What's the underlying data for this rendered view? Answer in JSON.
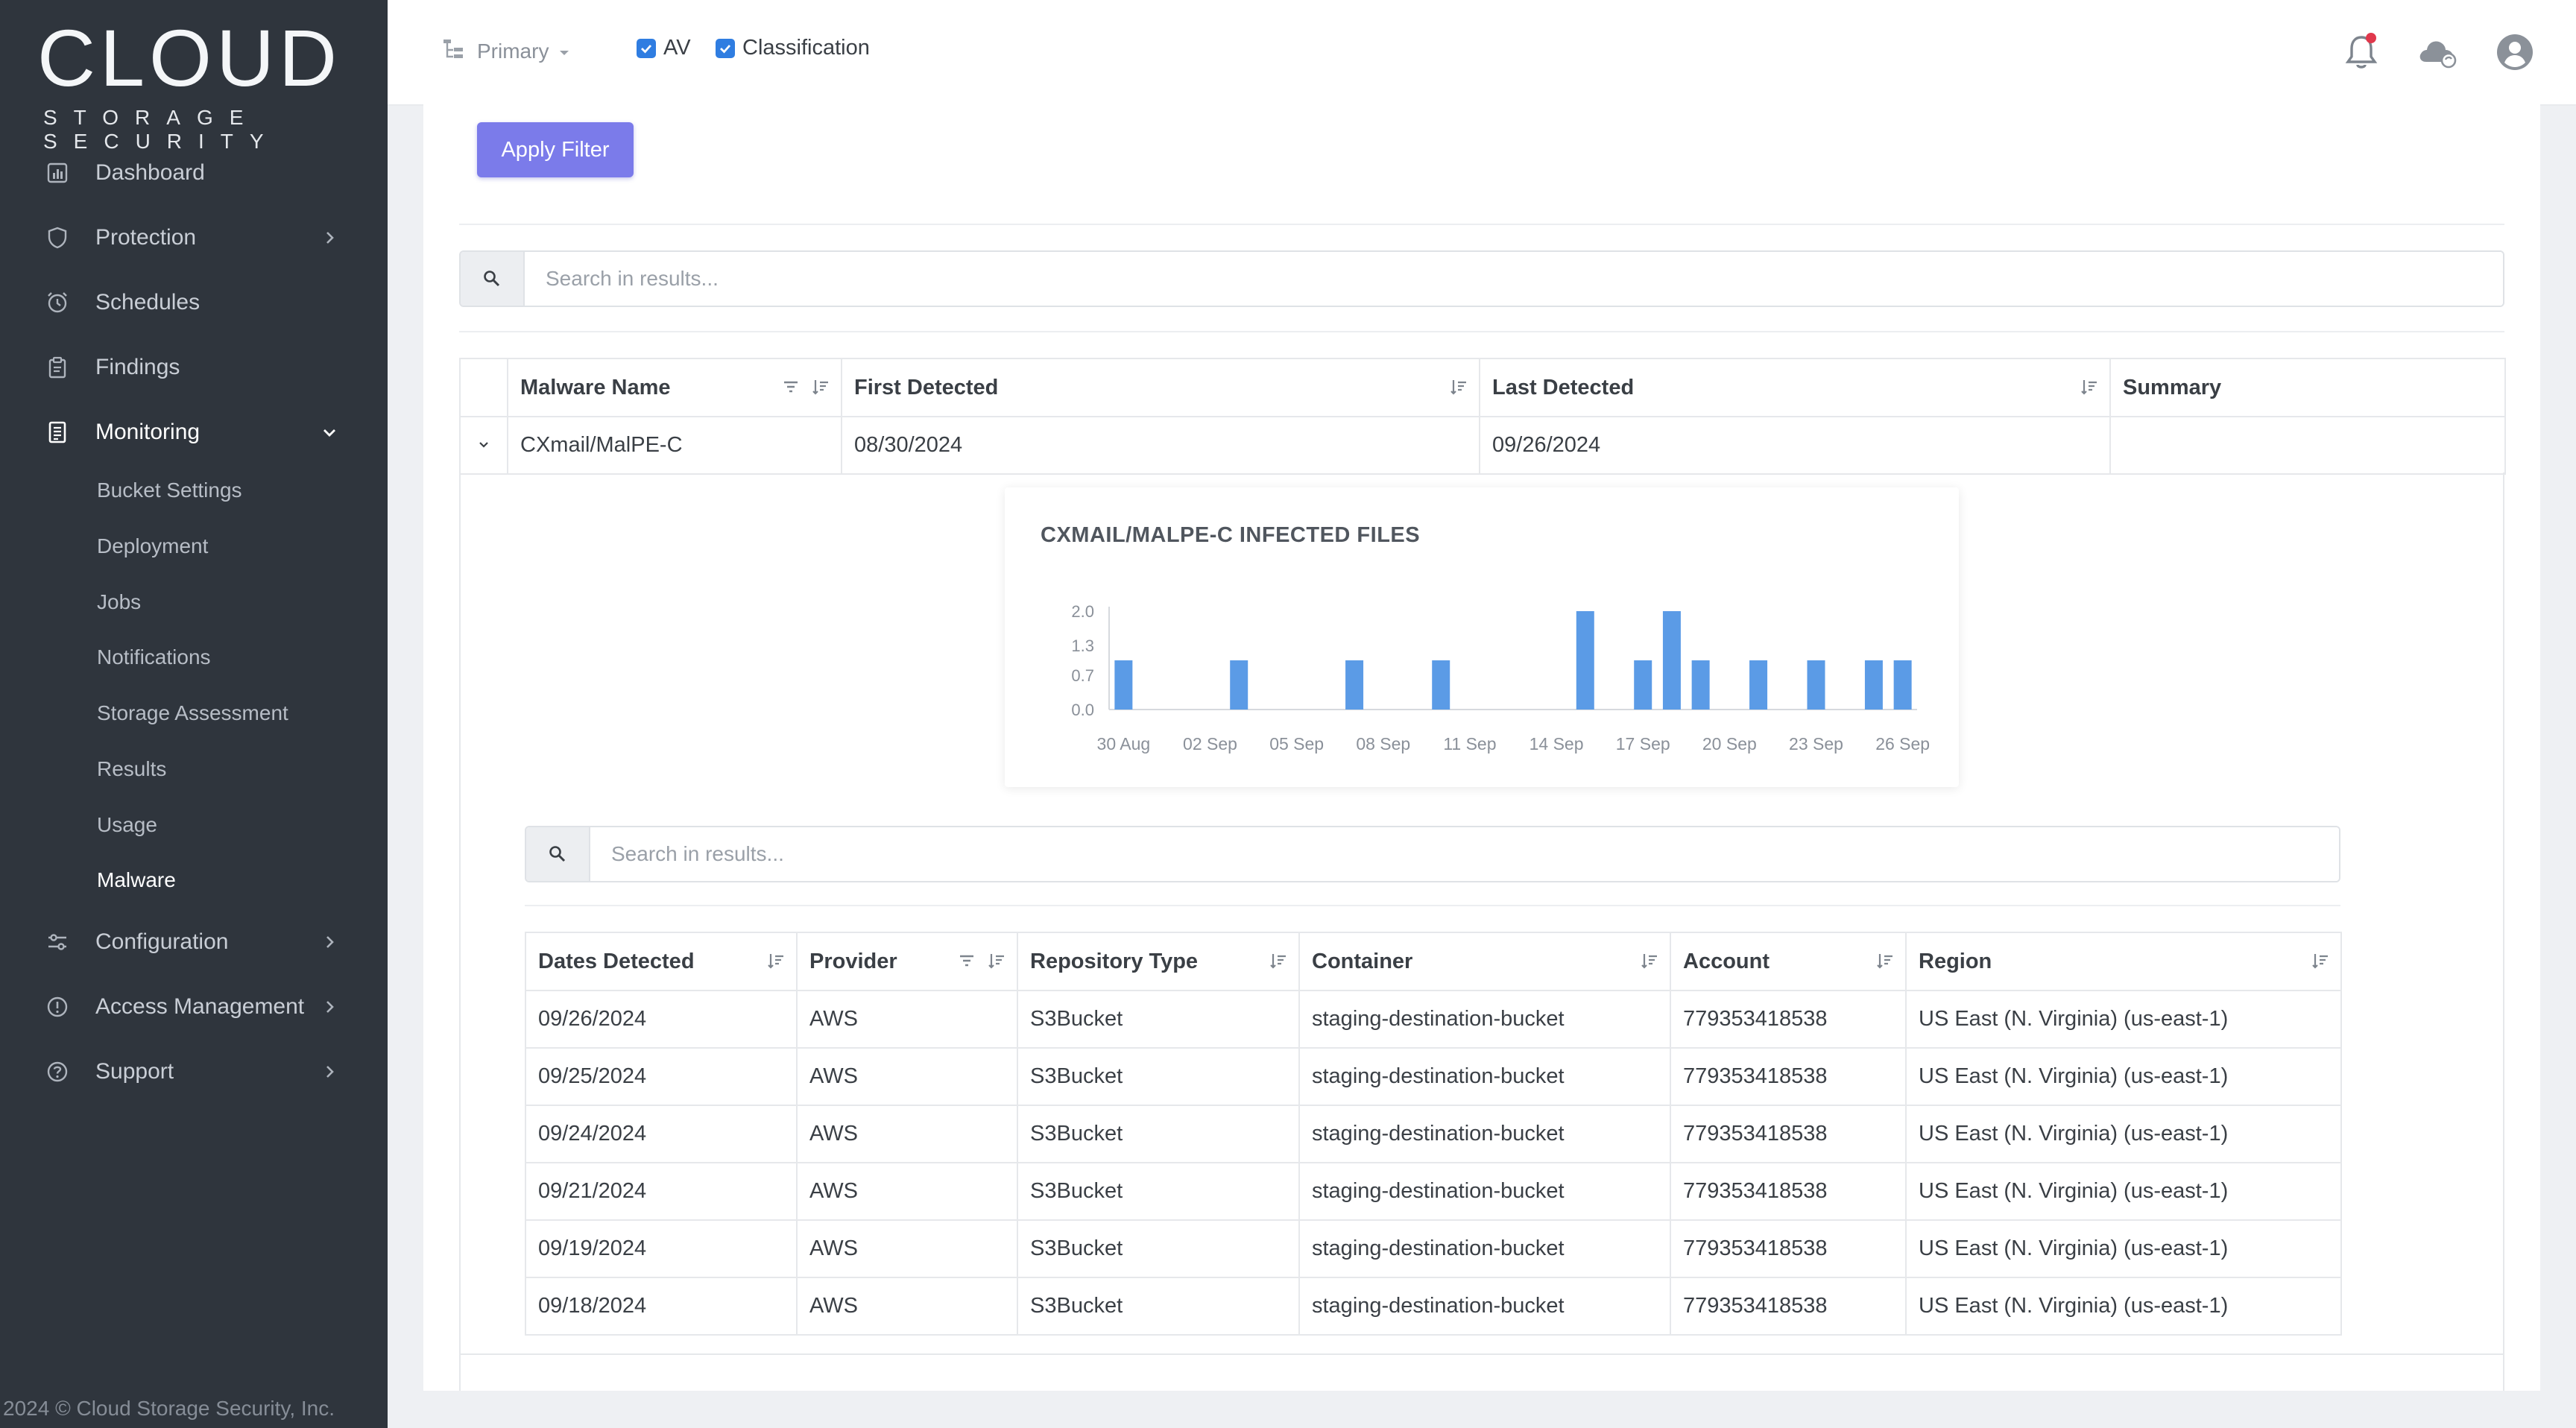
{
  "brand": {
    "main": "CLOUD",
    "sub": "STORAGE SECURITY"
  },
  "sidebar": {
    "items": [
      {
        "label": "Dashboard",
        "icon": "dashboard-icon",
        "chevron": false
      },
      {
        "label": "Protection",
        "icon": "shield-icon",
        "chevron": "right"
      },
      {
        "label": "Schedules",
        "icon": "alarm-clock-icon",
        "chevron": false
      },
      {
        "label": "Findings",
        "icon": "clipboard-icon",
        "chevron": false
      },
      {
        "label": "Monitoring",
        "icon": "document-icon",
        "chevron": "down"
      },
      {
        "label": "Configuration",
        "icon": "sliders-icon",
        "chevron": "right"
      },
      {
        "label": "Access Management",
        "icon": "info-circle-icon",
        "chevron": "right"
      },
      {
        "label": "Support",
        "icon": "help-circle-icon",
        "chevron": "right"
      }
    ],
    "monitoring_sub": [
      "Bucket Settings",
      "Deployment",
      "Jobs",
      "Notifications",
      "Storage Assessment",
      "Results",
      "Usage",
      "Malware"
    ],
    "active_sub": "Malware",
    "copyright": "2024 © Cloud Storage Security, Inc."
  },
  "topbar": {
    "account_selector": "Primary",
    "checkboxes": [
      {
        "label": "AV",
        "checked": true
      },
      {
        "label": "Classification",
        "checked": true
      }
    ],
    "icons": [
      "bell-icon",
      "cloud-sync-icon",
      "user-avatar-icon"
    ]
  },
  "filter": {
    "apply_label": "Apply Filter"
  },
  "search": {
    "placeholder": "Search in results..."
  },
  "malware_table": {
    "columns": [
      "Malware Name",
      "First Detected",
      "Last Detected",
      "Summary"
    ],
    "rows": [
      {
        "name": "CXmail/MalPE-C",
        "first": "08/30/2024",
        "last": "09/26/2024",
        "summary": ""
      }
    ]
  },
  "chart_data": {
    "type": "bar",
    "title": "CXMAIL/MALPE-C INFECTED FILES",
    "ylim": [
      0,
      2
    ],
    "yticks": [
      "0.0",
      "0.7",
      "1.3",
      "2.0"
    ],
    "xtick_labels": [
      "30 Aug",
      "02 Sep",
      "05 Sep",
      "08 Sep",
      "11 Sep",
      "14 Sep",
      "17 Sep",
      "20 Sep",
      "23 Sep",
      "26 Sep"
    ],
    "categories": [
      "30 Aug",
      "31 Aug",
      "01 Sep",
      "02 Sep",
      "03 Sep",
      "04 Sep",
      "05 Sep",
      "06 Sep",
      "07 Sep",
      "08 Sep",
      "09 Sep",
      "10 Sep",
      "11 Sep",
      "12 Sep",
      "13 Sep",
      "14 Sep",
      "15 Sep",
      "16 Sep",
      "17 Sep",
      "18 Sep",
      "19 Sep",
      "20 Sep",
      "21 Sep",
      "22 Sep",
      "23 Sep",
      "24 Sep",
      "25 Sep",
      "26 Sep"
    ],
    "values": [
      1,
      0,
      0,
      0,
      1,
      0,
      0,
      0,
      1,
      0,
      0,
      1,
      0,
      0,
      0,
      0,
      2,
      0,
      1,
      2,
      1,
      0,
      1,
      0,
      1,
      0,
      1,
      1
    ],
    "color": "#5b9be6",
    "xlabel": "",
    "ylabel": ""
  },
  "detections_table": {
    "columns": [
      "Dates Detected",
      "Provider",
      "Repository Type",
      "Container",
      "Account",
      "Region"
    ],
    "rows": [
      [
        "09/26/2024",
        "AWS",
        "S3Bucket",
        "staging-destination-bucket",
        "779353418538",
        "US East (N. Virginia) (us-east-1)"
      ],
      [
        "09/25/2024",
        "AWS",
        "S3Bucket",
        "staging-destination-bucket",
        "779353418538",
        "US East (N. Virginia) (us-east-1)"
      ],
      [
        "09/24/2024",
        "AWS",
        "S3Bucket",
        "staging-destination-bucket",
        "779353418538",
        "US East (N. Virginia) (us-east-1)"
      ],
      [
        "09/21/2024",
        "AWS",
        "S3Bucket",
        "staging-destination-bucket",
        "779353418538",
        "US East (N. Virginia) (us-east-1)"
      ],
      [
        "09/19/2024",
        "AWS",
        "S3Bucket",
        "staging-destination-bucket",
        "779353418538",
        "US East (N. Virginia) (us-east-1)"
      ],
      [
        "09/18/2024",
        "AWS",
        "S3Bucket",
        "staging-destination-bucket",
        "779353418538",
        "US East (N. Virginia) (us-east-1)"
      ]
    ]
  }
}
